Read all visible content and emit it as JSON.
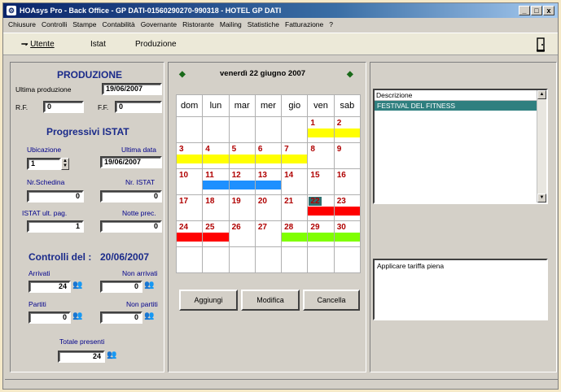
{
  "window": {
    "title": "HOAsys Pro  -  Back Office - GP DATI-01560290270-990318 - HOTEL GP DATI",
    "controls": [
      "_",
      "□",
      "x"
    ]
  },
  "menu": [
    "Chiusure",
    "Controlli",
    "Stampe",
    "Contabilità",
    "Governante",
    "Ristorante",
    "Mailing",
    "Statistiche",
    "Fatturazione",
    "?"
  ],
  "toolbar": {
    "utente": "Utente",
    "istat": "Istat",
    "produzione": "Produzione"
  },
  "produzione": {
    "title": "PRODUZIONE",
    "ultima_label": "Ultima produzione",
    "ultima_value": "19/06/2007",
    "rf_label": "R.F.",
    "rf_value": "0",
    "ff_label": "F.F.",
    "ff_value": "0"
  },
  "istat": {
    "title": "Progressivi ISTAT",
    "ubicazione_label": "Ubicazione",
    "ubicazione_value": "1",
    "ultima_data_label": "Ultima data",
    "ultima_data_value": "19/06/2007",
    "nr_schedina_label": "Nr.Schedina",
    "nr_schedina_value": "0",
    "nr_istat_label": "Nr. ISTAT",
    "nr_istat_value": "0",
    "ult_pag_label": "ISTAT ult. pag.",
    "ult_pag_value": "1",
    "notte_prec_label": "Notte prec.",
    "notte_prec_value": "0"
  },
  "controlli": {
    "title": "Controlli del :",
    "date": "20/06/2007",
    "arrivati_label": "Arrivati",
    "arrivati_value": "24",
    "non_arrivati_label": "Non arrivati",
    "non_arrivati_value": "0",
    "partiti_label": "Partiti",
    "partiti_value": "0",
    "non_partiti_label": "Non partiti",
    "non_partiti_value": "0",
    "totale_label": "Totale presenti",
    "totale_value": "24"
  },
  "calendar": {
    "date_label": "venerdì 22 giugno 2007",
    "weekdays": [
      "dom",
      "lun",
      "mar",
      "mer",
      "gio",
      "ven",
      "sab"
    ],
    "weeks": [
      [
        {
          "d": ""
        },
        {
          "d": ""
        },
        {
          "d": ""
        },
        {
          "d": ""
        },
        {
          "d": ""
        },
        {
          "d": "1",
          "bar": "#ffff00"
        },
        {
          "d": "2",
          "bar": "#ffff00"
        }
      ],
      [
        {
          "d": "3",
          "bar": "#ffff00"
        },
        {
          "d": "4",
          "bar": "#ffff00"
        },
        {
          "d": "5",
          "bar": "#ffff00"
        },
        {
          "d": "6",
          "bar": "#ffff00"
        },
        {
          "d": "7",
          "bar": "#ffff00"
        },
        {
          "d": "8"
        },
        {
          "d": "9"
        }
      ],
      [
        {
          "d": "10"
        },
        {
          "d": "11",
          "bar": "#1e90ff"
        },
        {
          "d": "12",
          "bar": "#1e90ff"
        },
        {
          "d": "13",
          "bar": "#1e90ff"
        },
        {
          "d": "14"
        },
        {
          "d": "15"
        },
        {
          "d": "16"
        }
      ],
      [
        {
          "d": "17"
        },
        {
          "d": "18"
        },
        {
          "d": "19"
        },
        {
          "d": "20"
        },
        {
          "d": "21"
        },
        {
          "d": "22",
          "bar": "#ff0000",
          "selected": true
        },
        {
          "d": "23",
          "bar": "#ff0000"
        }
      ],
      [
        {
          "d": "24",
          "bar": "#ff0000"
        },
        {
          "d": "25",
          "bar": "#ff0000"
        },
        {
          "d": "26"
        },
        {
          "d": "27"
        },
        {
          "d": "28",
          "bar": "#7fff00"
        },
        {
          "d": "29",
          "bar": "#7fff00"
        },
        {
          "d": "30",
          "bar": "#7fff00"
        }
      ],
      [
        {
          "d": ""
        },
        {
          "d": ""
        },
        {
          "d": ""
        },
        {
          "d": ""
        },
        {
          "d": ""
        },
        {
          "d": ""
        },
        {
          "d": ""
        }
      ]
    ],
    "selected_color": "#2f6f6f"
  },
  "buttons": {
    "aggiungi": "Aggiungi",
    "modifica": "Modifica",
    "cancella": "Cancella"
  },
  "events": {
    "header": "Descrizione",
    "items": [
      "FESTIVAL DEL FITNESS"
    ],
    "selected_color": "#2f7f7f"
  },
  "note": {
    "text": "Applicare tariffa piena"
  }
}
